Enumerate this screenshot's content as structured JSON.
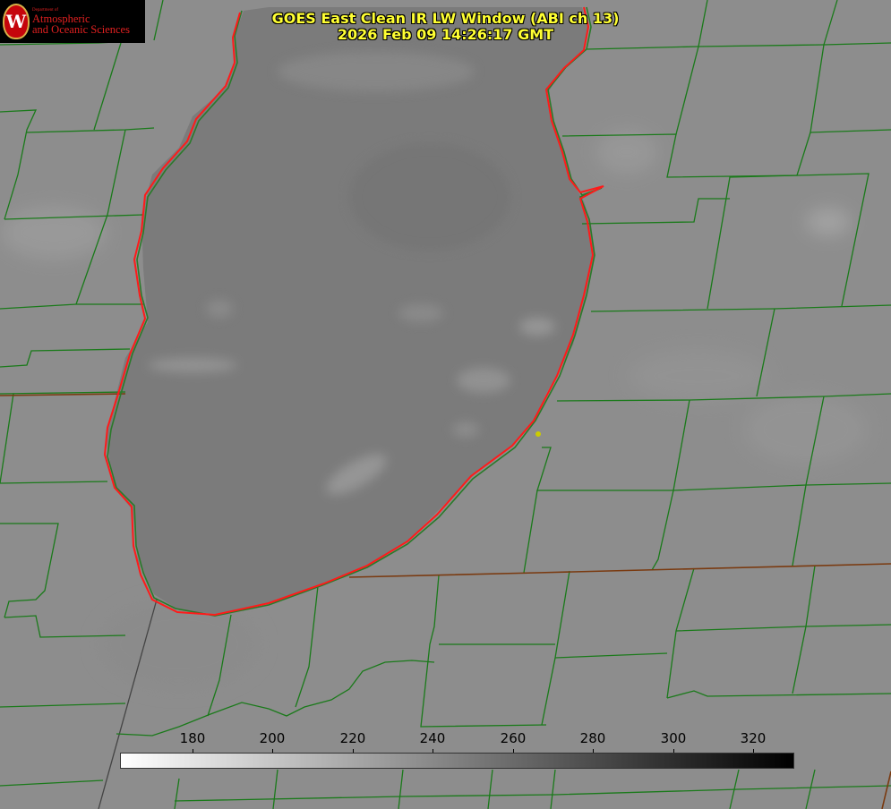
{
  "logo": {
    "department": "Department of",
    "line1": "Atmospheric",
    "line2": "and Oceanic Sciences",
    "seal_letter": "W"
  },
  "title": {
    "line1": "GOES East Clean IR LW Window (ABI ch 13)",
    "line2": "2026 Feb 09 14:26:17 GMT"
  },
  "colorbar": {
    "ticks": [
      "180",
      "200",
      "220",
      "240",
      "260",
      "280",
      "300",
      "320"
    ]
  },
  "colors": {
    "land_ir": "#8f8f8f",
    "lake_ir": "#7c7c7c",
    "county_lines": "#1a7a1a",
    "shoreline": "#ff1a1a",
    "title_text": "#ffff33",
    "marker": "#cccc00"
  },
  "map_features": {
    "water_body": "lake",
    "boundaries": [
      "county-lines",
      "state-lines",
      "shoreline"
    ],
    "marker": "site-dot"
  }
}
